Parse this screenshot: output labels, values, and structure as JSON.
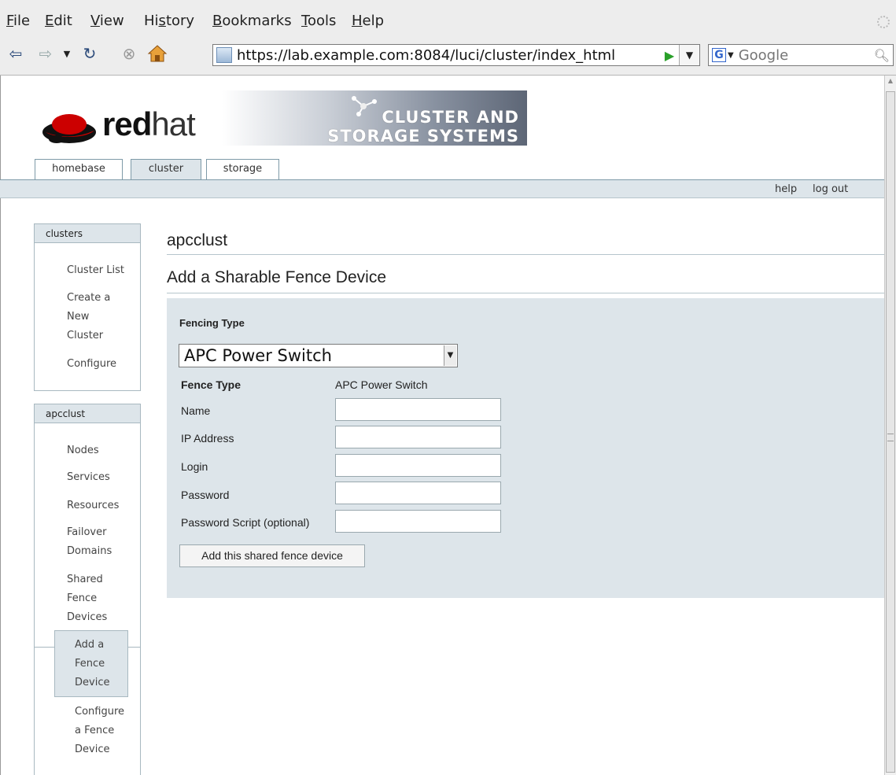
{
  "browser": {
    "menu": [
      "File",
      "Edit",
      "View",
      "History",
      "Bookmarks",
      "Tools",
      "Help"
    ],
    "menu_mnemonics": [
      "F",
      "E",
      "V",
      "s",
      "B",
      "T",
      "H"
    ],
    "url": "https://lab.example.com:8084/luci/cluster/index_html",
    "search_placeholder": "Google",
    "search_engine_letter": "G"
  },
  "header": {
    "logo_red": "red",
    "logo_hat": "hat",
    "banner_line1": "CLUSTER AND",
    "banner_line2": "STORAGE SYSTEMS"
  },
  "tabs": [
    {
      "label": "homebase"
    },
    {
      "label": "cluster",
      "active": true
    },
    {
      "label": "storage"
    }
  ],
  "toplinks": {
    "help": "help",
    "logout": "log out"
  },
  "sidebar": {
    "clusters_header": "clusters",
    "clusters_items": [
      "Cluster List",
      "Create a",
      "New",
      "Cluster",
      "Configure"
    ],
    "cluster_header": "apcclust",
    "cluster_items": [
      "Nodes",
      "Services",
      "Resources",
      "Failover",
      "Domains",
      "Shared",
      "Fence",
      "Devices"
    ],
    "active_items": [
      "Add a",
      "Fence",
      "Device"
    ],
    "sub_items": [
      "Configure",
      "a Fence",
      "Device"
    ]
  },
  "main": {
    "cluster_name": "apcclust",
    "form_title": "Add a Sharable Fence Device",
    "fencing_type_label": "Fencing Type",
    "fencing_type_selected": "APC Power Switch",
    "fence_type_label": "Fence Type",
    "fence_type_value": "APC Power Switch",
    "fields": [
      {
        "label": "Name",
        "value": ""
      },
      {
        "label": "IP Address",
        "value": ""
      },
      {
        "label": "Login",
        "value": ""
      },
      {
        "label": "Password",
        "value": ""
      },
      {
        "label": "Password Script (optional)",
        "value": ""
      }
    ],
    "submit_label": "Add this shared fence device"
  },
  "colors": {
    "panel": "#dde5ea",
    "border": "#7e9aa8",
    "logo_red": "#cc0000"
  }
}
